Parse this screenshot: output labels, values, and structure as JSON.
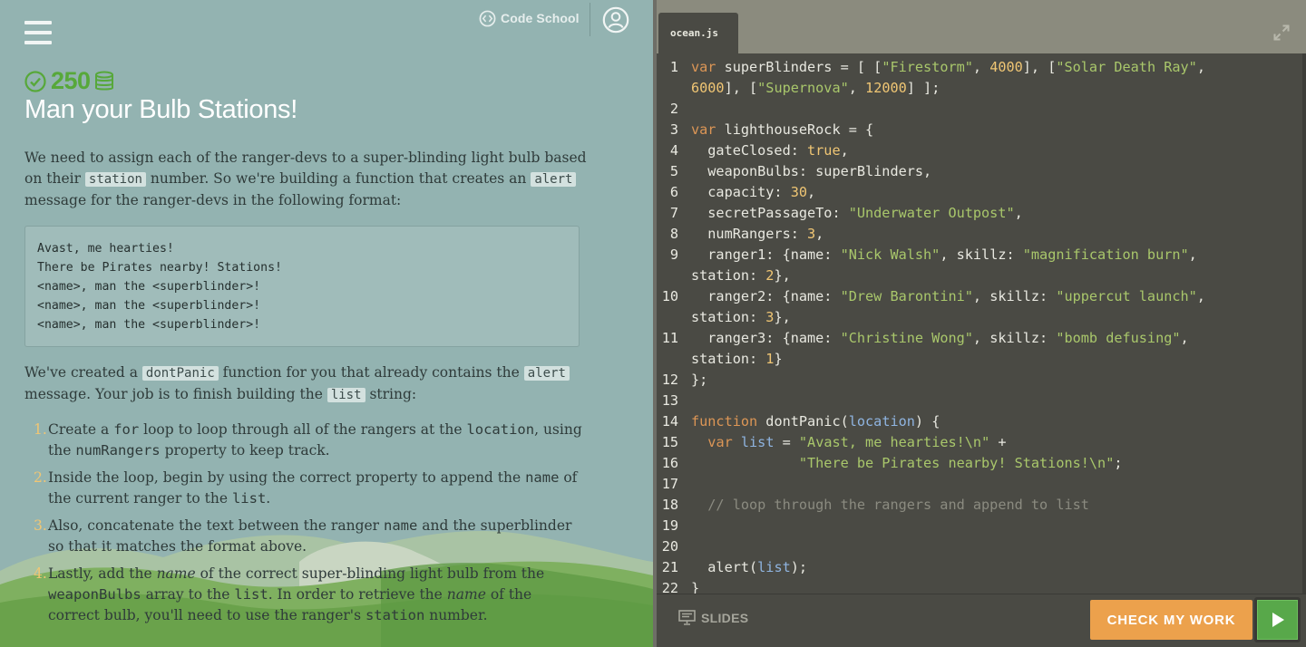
{
  "header": {
    "brand": "Code School",
    "menu_icon": "hamburger-menu-icon",
    "avatar_icon": "user-avatar-icon"
  },
  "challenge": {
    "points": "250",
    "title": "Man your Bulb Stations!"
  },
  "instructions": {
    "intro": {
      "t1": "We need to assign each of the ranger-devs to a super-blinding light bulb based on their ",
      "c1": "station",
      "t2": " number. So we're building a function that creates an ",
      "c2": "alert",
      "t3": " message for the ranger-devs in the following format:"
    },
    "example_lines": [
      "Avast, me hearties!",
      "There be Pirates nearby! Stations!",
      "<name>, man the <superblinder>!",
      "<name>, man the <superblinder>!",
      "<name>, man the <superblinder>!"
    ],
    "para2": {
      "t1": "We've created a ",
      "c1": "dontPanic",
      "t2": " function for you that already contains the ",
      "c2": "alert",
      "t3": " message. Your job is to finish building the ",
      "c3": "list",
      "t4": " string:"
    },
    "steps": [
      {
        "n": "1.",
        "t1": "Create a ",
        "c1": "for",
        "t2": " loop to loop through all of the rangers at the ",
        "c2": "location",
        "t3": ", using the ",
        "c3": "numRangers",
        "t4": " property to keep track."
      },
      {
        "n": "2.",
        "t1": "Inside the loop, begin by using the correct property to append the ",
        "c1": "name",
        "t2": " of the current ranger to the ",
        "c2": "list",
        "t3": "."
      },
      {
        "n": "3.",
        "t1": "Also, concatenate the text between the ranger ",
        "c1": "name",
        "t2": " and the superblinder so that it matches the format above."
      },
      {
        "n": "4.",
        "t1": "Lastly, add the ",
        "e1": "name",
        "t2": " of the correct super-blinding light bulb from the ",
        "c1": "weaponBulbs",
        "t3": " array to the ",
        "c2": "list",
        "t4": ". In order to retrieve the ",
        "e2": "name",
        "t5": " of the correct bulb, you'll need to use the ranger's ",
        "c3": "station",
        "t6": " number."
      }
    ]
  },
  "editor": {
    "file_tab": "ocean.js",
    "lines": [
      {
        "n": "1",
        "tokens": [
          [
            "kw",
            "var"
          ],
          [
            "plain",
            " superBlinders = [ ["
          ],
          [
            "str",
            "\"Firestorm\""
          ],
          [
            "plain",
            ", "
          ],
          [
            "num",
            "4000"
          ],
          [
            "plain",
            "], ["
          ],
          [
            "str",
            "\"Solar Death Ray\""
          ],
          [
            "plain",
            ","
          ]
        ]
      },
      {
        "n": "",
        "tokens": [
          [
            "num",
            "6000"
          ],
          [
            "plain",
            "], ["
          ],
          [
            "str",
            "\"Supernova\""
          ],
          [
            "plain",
            ", "
          ],
          [
            "num",
            "12000"
          ],
          [
            "plain",
            "] ];"
          ]
        ]
      },
      {
        "n": "2",
        "tokens": []
      },
      {
        "n": "3",
        "tokens": [
          [
            "kw",
            "var"
          ],
          [
            "plain",
            " lighthouseRock = {"
          ]
        ]
      },
      {
        "n": "4",
        "tokens": [
          [
            "plain",
            "  gateClosed: "
          ],
          [
            "bool",
            "true"
          ],
          [
            "plain",
            ","
          ]
        ]
      },
      {
        "n": "5",
        "tokens": [
          [
            "plain",
            "  weaponBulbs: superBlinders,"
          ]
        ]
      },
      {
        "n": "6",
        "tokens": [
          [
            "plain",
            "  capacity: "
          ],
          [
            "num",
            "30"
          ],
          [
            "plain",
            ","
          ]
        ]
      },
      {
        "n": "7",
        "tokens": [
          [
            "plain",
            "  secretPassageTo: "
          ],
          [
            "str",
            "\"Underwater Outpost\""
          ],
          [
            "plain",
            ","
          ]
        ]
      },
      {
        "n": "8",
        "tokens": [
          [
            "plain",
            "  numRangers: "
          ],
          [
            "num",
            "3"
          ],
          [
            "plain",
            ","
          ]
        ]
      },
      {
        "n": "9",
        "tokens": [
          [
            "plain",
            "  ranger1: {name: "
          ],
          [
            "str",
            "\"Nick Walsh\""
          ],
          [
            "plain",
            ", skillz: "
          ],
          [
            "str",
            "\"magnification burn\""
          ],
          [
            "plain",
            ","
          ]
        ]
      },
      {
        "n": "",
        "tokens": [
          [
            "plain",
            "station: "
          ],
          [
            "num",
            "2"
          ],
          [
            "plain",
            "},"
          ]
        ]
      },
      {
        "n": "10",
        "tokens": [
          [
            "plain",
            "  ranger2: {name: "
          ],
          [
            "str",
            "\"Drew Barontini\""
          ],
          [
            "plain",
            ", skillz: "
          ],
          [
            "str",
            "\"uppercut launch\""
          ],
          [
            "plain",
            ","
          ]
        ]
      },
      {
        "n": "",
        "tokens": [
          [
            "plain",
            "station: "
          ],
          [
            "num",
            "3"
          ],
          [
            "plain",
            "},"
          ]
        ]
      },
      {
        "n": "11",
        "tokens": [
          [
            "plain",
            "  ranger3: {name: "
          ],
          [
            "str",
            "\"Christine Wong\""
          ],
          [
            "plain",
            ", skillz: "
          ],
          [
            "str",
            "\"bomb defusing\""
          ],
          [
            "plain",
            ","
          ]
        ]
      },
      {
        "n": "",
        "tokens": [
          [
            "plain",
            "station: "
          ],
          [
            "num",
            "1"
          ],
          [
            "plain",
            "}"
          ]
        ]
      },
      {
        "n": "12",
        "tokens": [
          [
            "plain",
            "};"
          ]
        ]
      },
      {
        "n": "13",
        "tokens": []
      },
      {
        "n": "14",
        "tokens": [
          [
            "kw",
            "function"
          ],
          [
            "plain",
            " dontPanic("
          ],
          [
            "param",
            "location"
          ],
          [
            "plain",
            ") {"
          ]
        ]
      },
      {
        "n": "15",
        "tokens": [
          [
            "plain",
            "  "
          ],
          [
            "kw",
            "var"
          ],
          [
            "plain",
            " "
          ],
          [
            "param",
            "list"
          ],
          [
            "plain",
            " = "
          ],
          [
            "str",
            "\"Avast, me hearties!\\n\""
          ],
          [
            "plain",
            " +"
          ]
        ]
      },
      {
        "n": "16",
        "tokens": [
          [
            "plain",
            "             "
          ],
          [
            "str",
            "\"There be Pirates nearby! Stations!\\n\""
          ],
          [
            "plain",
            ";"
          ]
        ]
      },
      {
        "n": "17",
        "tokens": []
      },
      {
        "n": "18",
        "tokens": [
          [
            "cmt",
            "  // loop through the rangers and append to list"
          ]
        ]
      },
      {
        "n": "19",
        "tokens": []
      },
      {
        "n": "20",
        "tokens": []
      },
      {
        "n": "21",
        "tokens": [
          [
            "plain",
            "  alert("
          ],
          [
            "param",
            "list"
          ],
          [
            "plain",
            ");"
          ]
        ]
      },
      {
        "n": "22",
        "tokens": [
          [
            "plain",
            "}"
          ]
        ]
      }
    ]
  },
  "footer": {
    "slides_label": "SLIDES",
    "check_label": "CHECK MY WORK",
    "run_icon": "play-icon"
  },
  "colors": {
    "left_bg": "#93b3b1",
    "accent_green": "#57a83a",
    "editor_bg": "#4a4a44",
    "check_button": "#eca14c",
    "run_button": "#58a84a"
  }
}
